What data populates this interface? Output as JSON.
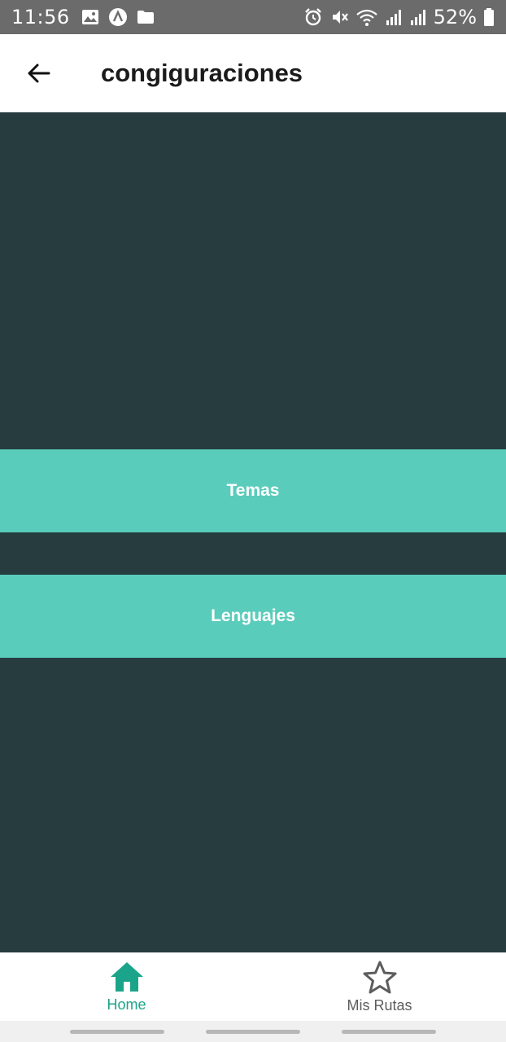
{
  "status_bar": {
    "time": "11:56",
    "battery_percent": "52%",
    "icons": [
      "image-icon",
      "assistant-icon",
      "folder-icon",
      "alarm-icon",
      "vibrate-icon",
      "wifi-icon",
      "signal-icon",
      "signal-icon",
      "battery-icon"
    ]
  },
  "app_bar": {
    "title": "congiguraciones",
    "back_icon": "arrow-back-icon"
  },
  "menu": {
    "temas_label": "Temas",
    "lenguajes_label": "Lenguajes"
  },
  "bottom_nav": {
    "items": [
      {
        "label": "Home",
        "icon": "home-icon",
        "active": true
      },
      {
        "label": "Mis Rutas",
        "icon": "star-icon",
        "active": false
      }
    ]
  },
  "colors": {
    "background": "#263c3f",
    "button": "#5accbc",
    "active_nav": "#1aa58a",
    "inactive_nav": "#5d5d5d"
  }
}
